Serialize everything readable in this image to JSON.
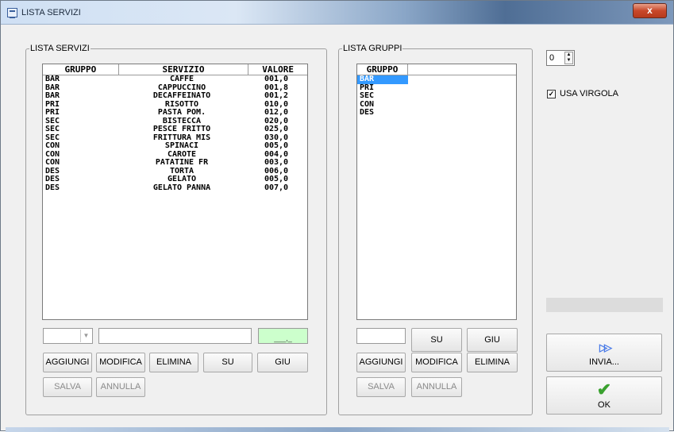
{
  "window": {
    "title": "LISTA SERVIZI",
    "close_glyph": "x"
  },
  "servizi": {
    "legend": "LISTA SERVIZI",
    "columns": [
      "GRUPPO",
      "SERVIZIO",
      "VALORE"
    ],
    "rows": [
      [
        "BAR",
        "CAFFE",
        "001,0"
      ],
      [
        "BAR",
        "CAPPUCCINO",
        "001,8"
      ],
      [
        "BAR",
        "DECAFFEINATO",
        "001,2"
      ],
      [
        "PRI",
        "RISOTTO",
        "010,0"
      ],
      [
        "PRI",
        "PASTA POM.",
        "012,0"
      ],
      [
        "SEC",
        "BISTECCA",
        "020,0"
      ],
      [
        "SEC",
        "PESCE FRITTO",
        "025,0"
      ],
      [
        "SEC",
        "FRITTURA MIS",
        "030,0"
      ],
      [
        "CON",
        "SPINACI",
        "005,0"
      ],
      [
        "CON",
        "CAROTE",
        "004,0"
      ],
      [
        "CON",
        "PATATINE FR",
        "003,0"
      ],
      [
        "DES",
        "TORTA",
        "006,0"
      ],
      [
        "DES",
        "GELATO",
        "005,0"
      ],
      [
        "DES",
        "GELATO PANNA",
        "007,0"
      ]
    ],
    "value_input": "___,_",
    "value_input_color": "#ccffcc",
    "buttons": {
      "aggiungi": "AGGIUNGI",
      "modifica": "MODIFICA",
      "elimina": "ELIMINA",
      "su": "SU",
      "giu": "GIU",
      "salva": "SALVA",
      "annulla": "ANNULLA"
    }
  },
  "gruppi": {
    "legend": "LISTA GRUPPI",
    "column": "GRUPPO",
    "items": [
      "BAR",
      "PRI",
      "SEC",
      "CON",
      "DES"
    ],
    "selected_index": 0,
    "buttons": {
      "su": "SU",
      "giu": "GIU",
      "aggiungi": "AGGIUNGI",
      "modifica": "MODIFICA",
      "elimina": "ELIMINA",
      "salva": "SALVA",
      "annulla": "ANNULLA"
    }
  },
  "side": {
    "spinner_value": "0",
    "usa_virgola_label": "USA VIRGOLA",
    "usa_virgola_checked": true,
    "invia_label": "INVIA...",
    "invia_icon": "double-arrow-right-icon",
    "ok_label": "OK",
    "ok_icon": "checkmark-icon"
  },
  "colors": {
    "selection": "#3399ff",
    "invia_arrow": "#4a7be8",
    "ok_check": "#3aa12f"
  }
}
